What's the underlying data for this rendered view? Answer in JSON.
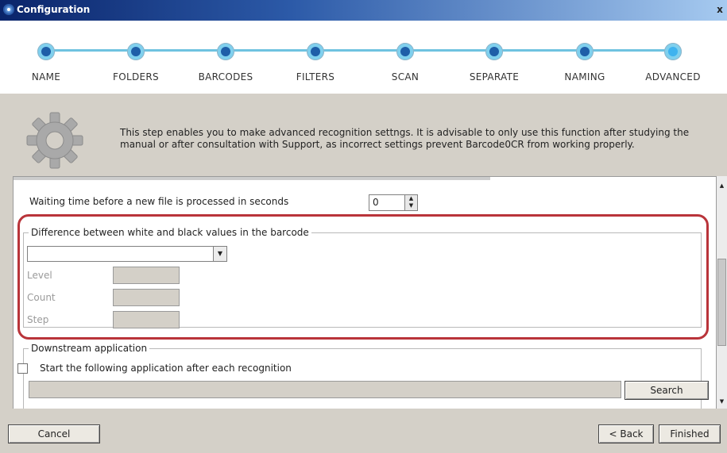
{
  "window": {
    "title": "Configuration",
    "close_glyph": "x"
  },
  "wizard": {
    "steps": [
      {
        "label": "NAME"
      },
      {
        "label": "FOLDERS"
      },
      {
        "label": "BARCODES"
      },
      {
        "label": "FILTERS"
      },
      {
        "label": "SCAN"
      },
      {
        "label": "SEPARATE"
      },
      {
        "label": "NAMING"
      },
      {
        "label": "ADVANCED"
      }
    ],
    "active_step": "ADVANCED",
    "track_color": "#6fc3e0",
    "dot_color": "#1e5ea8",
    "active_dot_color": "#3fb3ef"
  },
  "info": {
    "icon": "gear-icon",
    "text": "This step enables you to make advanced recognition settngs. It is advisable to only use this function after studying the manual or after consultation with Support, as incorrect settings prevent Barcode0CR from working properly."
  },
  "settings": {
    "waiting_label": "Waiting time before a new file is processed in seconds",
    "waiting_value": "0",
    "difference_group": {
      "title": "Difference between white and black values in the barcode",
      "selected": "",
      "fields": [
        {
          "label": "Level"
        },
        {
          "label": "Count"
        },
        {
          "label": "Step"
        }
      ]
    },
    "downstream_group": {
      "title": "Downstream application",
      "checkbox_label": "Start the following application after each recognition",
      "checked": false,
      "path_value": "",
      "search_label": "Search"
    }
  },
  "highlight_color": "#b9343a",
  "footer": {
    "cancel_label": "Cancel",
    "back_label": "< Back",
    "finish_label": "Finished"
  }
}
